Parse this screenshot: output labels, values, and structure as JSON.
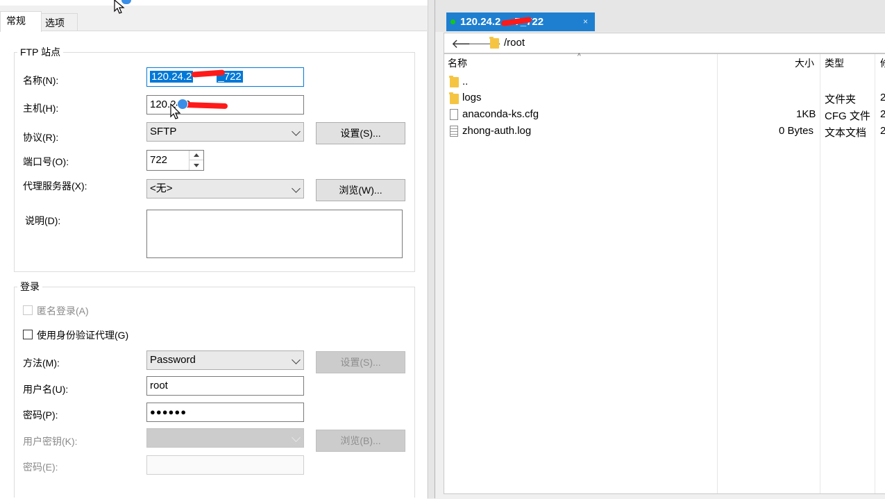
{
  "dialog": {
    "tabs": [
      {
        "label": "常规",
        "active": true
      },
      {
        "label": "选项",
        "active": false
      }
    ],
    "ftp_group": {
      "title": "FTP 站点",
      "name_label": "名称(N):",
      "name_value": "120.24.2",
      "name_value_tail": "_722",
      "host_label": "主机(H):",
      "host_value": "120.24.2",
      "protocol_label": "协议(R):",
      "protocol_value": "SFTP",
      "settings_button": "设置(S)...",
      "port_label": "端口号(O):",
      "port_value": "722",
      "proxy_label": "代理服务器(X):",
      "proxy_value": "<无>",
      "browse_button": "浏览(W)...",
      "desc_label": "说明(D):"
    },
    "login_group": {
      "title": "登录",
      "anonymous_label": "匿名登录(A)",
      "agent_label": "使用身份验证代理(G)",
      "method_label": "方法(M):",
      "method_value": "Password",
      "method_settings_button": "设置(S)...",
      "user_label": "用户名(U):",
      "user_value": "root",
      "password_label": "密码(P):",
      "password_value": "●●●●●●",
      "userkey_label": "用户密钥(K):",
      "userkey_browse_button": "浏览(B)...",
      "passphrase_label": "密码(E):"
    }
  },
  "session": {
    "tab_label": "120.24.2",
    "tab_label_tail": "7_722",
    "close_label": "×",
    "path": "/root",
    "back_arrow": "🡐",
    "forward_arrow": "🡒",
    "columns": {
      "name": "名称",
      "size": "大小",
      "type": "类型",
      "modified": "修"
    },
    "files": [
      {
        "name": "..",
        "size": "",
        "type": "",
        "modified": "",
        "icon": "folder-icon"
      },
      {
        "name": "logs",
        "size": "",
        "type": "文件夹",
        "modified": "2",
        "icon": "folder-icon"
      },
      {
        "name": "anaconda-ks.cfg",
        "size": "1KB",
        "type": "CFG 文件",
        "modified": "2",
        "icon": "file-icon"
      },
      {
        "name": "zhong-auth.log",
        "size": "0 Bytes",
        "type": "文本文档",
        "modified": "2",
        "icon": "text-file-icon"
      }
    ]
  },
  "colors": {
    "tab_blue": "#1e7fd0",
    "selection_blue": "#0078d7",
    "connected_green": "#15c815",
    "redaction_red": "#ff1a1a",
    "folder_yellow": "#f5c542"
  }
}
